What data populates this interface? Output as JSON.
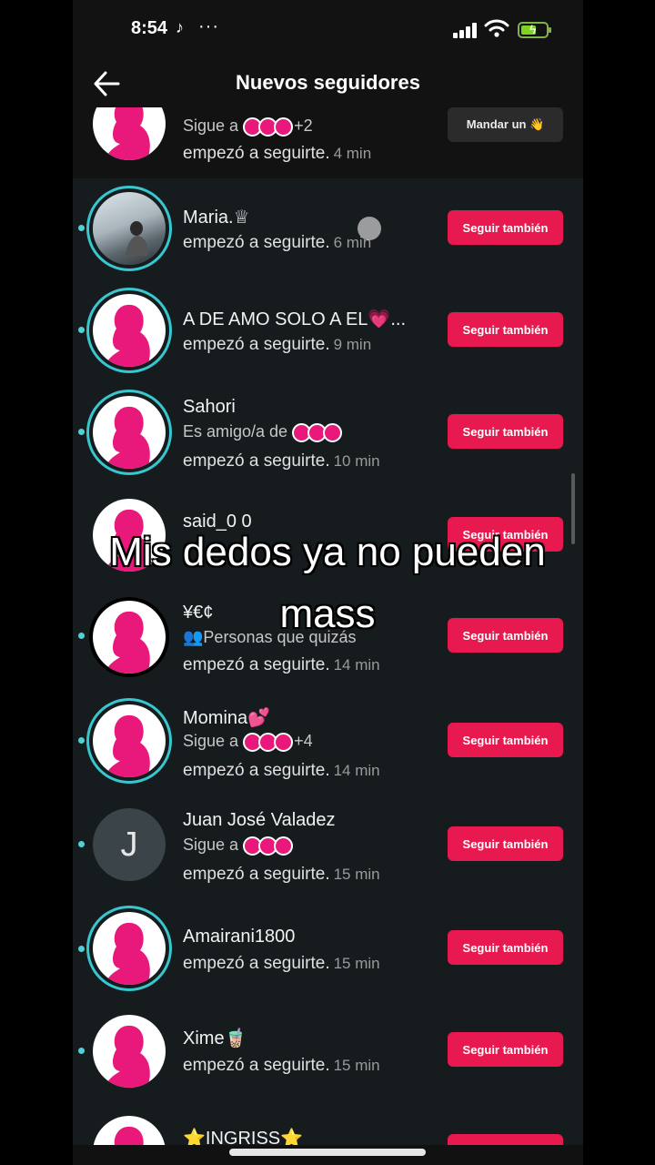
{
  "status_bar": {
    "time": "8:54",
    "app_icon": "tiktok-icon",
    "dots": "···"
  },
  "header": {
    "title": "Nuevos seguidores",
    "back_icon": "arrow-left-icon"
  },
  "followers": [
    {
      "name": "",
      "detail": "Sigue a",
      "detail_extra": "+2",
      "action": "empezó a seguirte.",
      "time": "4 min",
      "button": "Mandar un 👋"
    },
    {
      "name": "Maria.♕",
      "action": "empezó a seguirte.",
      "time": "6 min",
      "button": "Seguir también"
    },
    {
      "name": "A DE AMO SOLO A EL💗...",
      "action": "empezó a seguirte.",
      "time": "9 min",
      "button": "Seguir también"
    },
    {
      "name": "Sahori",
      "detail": "Es amigo/a de",
      "action": "empezó a seguirte.",
      "time": "10 min",
      "button": "Seguir también"
    },
    {
      "name": "said_0 0",
      "action": "",
      "time": "",
      "button": "Seguir también"
    },
    {
      "name": "¥€¢",
      "detail": "Personas que quizás",
      "action": "empezó a seguirte.",
      "time": "14 min",
      "button": "Seguir también"
    },
    {
      "name": "Momina💕",
      "detail": "Sigue a",
      "detail_extra": "+4",
      "action": "empezó a seguirte.",
      "time": "14 min",
      "button": "Seguir también"
    },
    {
      "name": "Juan José Valadez",
      "initial": "J",
      "detail": "Sigue a",
      "action": "empezó a seguirte.",
      "time": "15 min",
      "button": "Seguir también"
    },
    {
      "name": "Amairani1800",
      "action": "empezó a seguirte.",
      "time": "15 min",
      "button": "Seguir también"
    },
    {
      "name": "Xime🧋",
      "action": "empezó a seguirte.",
      "time": "15 min",
      "button": "Seguir también"
    },
    {
      "name": "⭐INGRISS⭐",
      "action": "",
      "time": "",
      "button": ""
    }
  ],
  "overlay_caption": {
    "line1": "Mis dedos ya no pueden",
    "line2": "mass"
  },
  "colors": {
    "accent": "#e8194f",
    "ring": "#38c7cf",
    "avatar_pink": "#e8197a",
    "background": "#161b1e"
  }
}
